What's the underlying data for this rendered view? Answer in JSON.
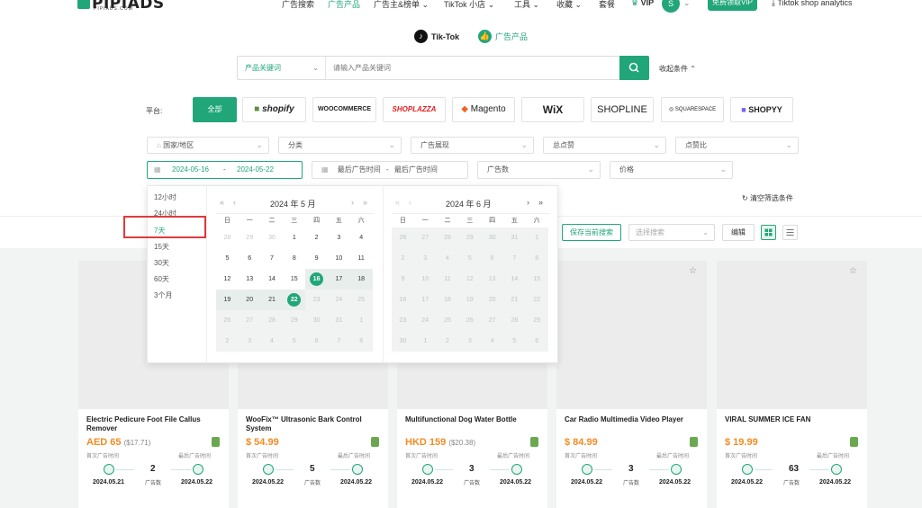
{
  "header": {
    "logo": "PIPIADS",
    "logo_sub": "PIPIADS.COM",
    "nav": [
      "广告搜索",
      "广告产品",
      "广告主&榜单",
      "TikTok 小店",
      "工具",
      "收藏",
      "套餐"
    ],
    "vip": "VIP",
    "avatar": "S",
    "vip_button": "免费领取VIP",
    "analytics": "Tiktok shop analytics"
  },
  "switch": {
    "tiktok": "Tik-Tok",
    "products": "广告产品"
  },
  "search": {
    "type": "产品关键词",
    "placeholder": "请输入产品关键词",
    "collapse": "收起条件"
  },
  "platform": {
    "label": "平台:",
    "items": [
      "全部",
      "shopify",
      "WOOCOMMERCE",
      "SHOPLAZZA",
      "Magento",
      "WiX",
      "SHOPLINE",
      "SQUARESPACE",
      "SHOPYY"
    ]
  },
  "filters": {
    "row1": [
      "国家/地区",
      "分类",
      "广告展现",
      "总点赞",
      "点赞比"
    ],
    "date_start": "2024-05-16",
    "date_sep": "-",
    "date_end": "2024-05-22",
    "last_ad_start": "最后广告时间",
    "last_ad_end": "最后广告时间",
    "ad_count": "广告数",
    "price": "价格",
    "clear": "清空筛选条件"
  },
  "datepicker": {
    "presets": [
      "12小时",
      "24小时",
      "7天",
      "15天",
      "30天",
      "60天",
      "3个月"
    ],
    "weekdays": [
      "日",
      "一",
      "二",
      "三",
      "四",
      "五",
      "六"
    ],
    "left_title": "2024 年 5 月",
    "right_title": "2024 年 6 月",
    "left_days": [
      [
        "28",
        "29",
        "30",
        "1",
        "2",
        "3",
        "4"
      ],
      [
        "5",
        "6",
        "7",
        "8",
        "9",
        "10",
        "11"
      ],
      [
        "12",
        "13",
        "14",
        "15",
        "16",
        "17",
        "18"
      ],
      [
        "19",
        "20",
        "21",
        "22",
        "23",
        "24",
        "25"
      ],
      [
        "26",
        "27",
        "28",
        "29",
        "30",
        "31",
        "1"
      ],
      [
        "2",
        "3",
        "4",
        "5",
        "6",
        "7",
        "8"
      ]
    ],
    "right_days": [
      [
        "26",
        "27",
        "28",
        "29",
        "30",
        "31",
        "1"
      ],
      [
        "2",
        "3",
        "4",
        "5",
        "6",
        "7",
        "8"
      ],
      [
        "9",
        "10",
        "11",
        "12",
        "13",
        "14",
        "15"
      ],
      [
        "16",
        "17",
        "18",
        "19",
        "20",
        "21",
        "22"
      ],
      [
        "23",
        "24",
        "25",
        "26",
        "27",
        "28",
        "29"
      ],
      [
        "30",
        "1",
        "2",
        "3",
        "4",
        "5",
        "6"
      ]
    ]
  },
  "toolbar": {
    "save": "保存当前搜索",
    "select_placeholder": "选择搜索",
    "edit": "编辑"
  },
  "cards": [
    {
      "title": "Electric Pedicure Foot File Callus Remover",
      "price": "AED 65",
      "orig": "($17.71)",
      "first_label": "首次广告时间",
      "last_label": "最后广告时间",
      "count": "2",
      "count_label": "广告数",
      "first": "2024.05.21",
      "last": "2024.05.22"
    },
    {
      "title": "WooFix™ Ultrasonic Bark Control System",
      "price": "$ 54.99",
      "orig": "",
      "first_label": "首次广告时间",
      "last_label": "最后广告时间",
      "count": "5",
      "count_label": "广告数",
      "first": "2024.05.22",
      "last": "2024.05.22"
    },
    {
      "title": "Multifunctional Dog Water Bottle",
      "price": "HKD 159",
      "orig": "($20.38)",
      "first_label": "首次广告时间",
      "last_label": "最后广告时间",
      "count": "3",
      "count_label": "广告数",
      "first": "2024.05.22",
      "last": "2024.05.22"
    },
    {
      "title": "Car Radio Multimedia Video Player",
      "price": "$ 84.99",
      "orig": "",
      "first_label": "首次广告时间",
      "last_label": "最后广告时间",
      "count": "3",
      "count_label": "广告数",
      "first": "2024.05.22",
      "last": "2024.05.22"
    },
    {
      "title": "VIRAL SUMMER ICE FAN",
      "price": "$ 19.99",
      "orig": "",
      "first_label": "首次广告时间",
      "last_label": "最后广告时间",
      "count": "63",
      "count_label": "广告数",
      "first": "2024.05.22",
      "last": "2024.05.22"
    }
  ],
  "colors": {
    "brand": "#21a67a",
    "price": "#f28b22",
    "highlight": "#e03a3a"
  }
}
